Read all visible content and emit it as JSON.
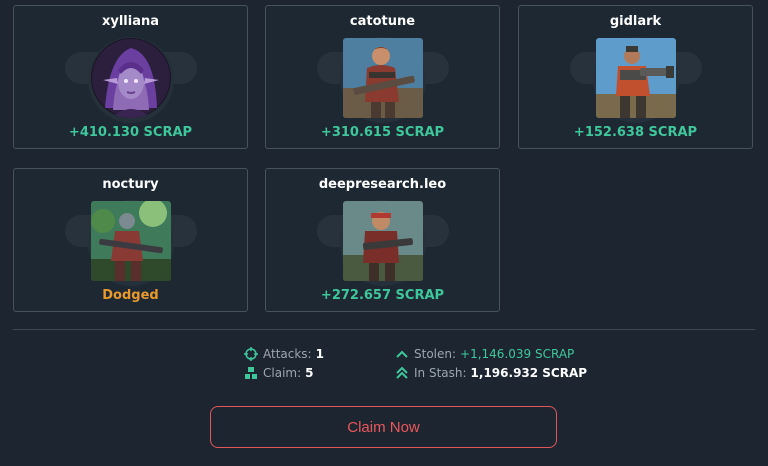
{
  "cards": [
    {
      "name": "xylliana",
      "result": "+410.130 SCRAP",
      "result_type": "gain",
      "avatar": "elf-woman-avatar"
    },
    {
      "name": "catotune",
      "result": "+310.615 SCRAP",
      "result_type": "gain",
      "avatar": "soldier-avatar"
    },
    {
      "name": "gidlark",
      "result": "+152.638 SCRAP",
      "result_type": "gain",
      "avatar": "heavy-gunner-avatar"
    },
    {
      "name": "noctury",
      "result": "Dodged",
      "result_type": "dodge",
      "avatar": "jungle-soldier-avatar"
    },
    {
      "name": "deepresearch.leo",
      "result": "+272.657 SCRAP",
      "result_type": "gain",
      "avatar": "commando-avatar"
    }
  ],
  "stats": {
    "attacks_label": "Attacks:",
    "attacks_value": "1",
    "claim_label": "Claim:",
    "claim_value": "5",
    "stolen_label": "Stolen:",
    "stolen_value": "+1,146.039 SCRAP",
    "stash_label": "In Stash:",
    "stash_value": "1,196.932 SCRAP"
  },
  "claim_button": {
    "label": "Claim Now"
  },
  "colors": {
    "background": "#1d2630",
    "card_border": "#46525e",
    "gain": "#3fc79c",
    "dodge": "#e7992e",
    "claim_accent": "#e9565c"
  }
}
